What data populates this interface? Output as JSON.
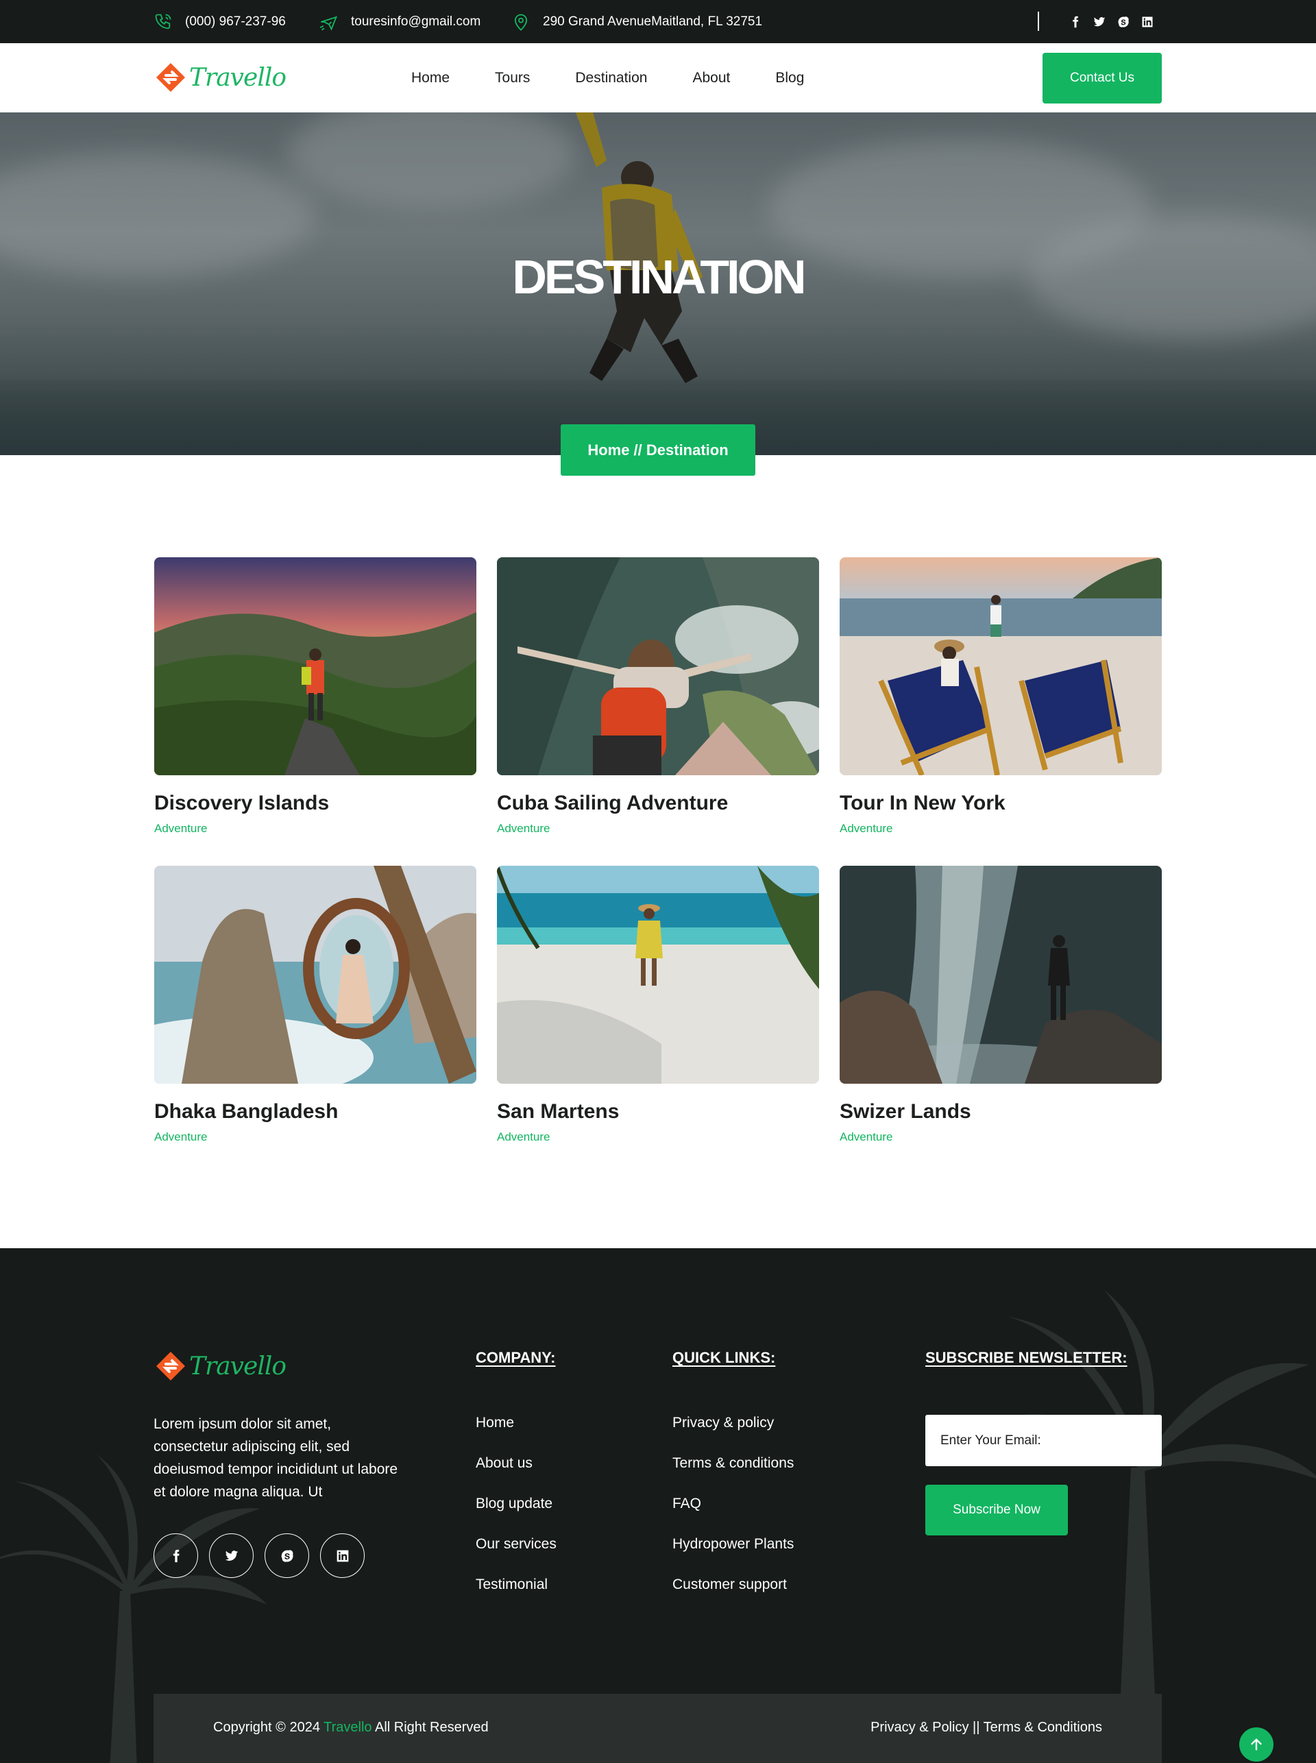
{
  "topbar": {
    "phone": "(000) 967-237-96",
    "email": "touresinfo@gmail.com",
    "address": "290 Grand AvenueMaitland, FL 32751",
    "icons": [
      "phone-icon",
      "plane-icon",
      "location-pin-icon"
    ],
    "socials": [
      "facebook-icon",
      "twitter-icon",
      "skype-icon",
      "linkedin-icon"
    ]
  },
  "brand": {
    "name": "Travello",
    "accent": "#13b561",
    "logo_mark_color": "#f25a22",
    "dark": "#171b19"
  },
  "nav": {
    "items": [
      "Home",
      "Tours",
      "Destination",
      "About",
      "Blog"
    ],
    "cta": "Contact Us"
  },
  "hero": {
    "title": "DESTINATION",
    "breadcrumb": "Home // Destination"
  },
  "destinations": [
    {
      "title": "Discovery Islands",
      "tag": "Adventure"
    },
    {
      "title": "Cuba Sailing Adventure",
      "tag": "Adventure"
    },
    {
      "title": "Tour In New York",
      "tag": "Adventure"
    },
    {
      "title": "Dhaka Bangladesh",
      "tag": "Adventure"
    },
    {
      "title": "San Martens",
      "tag": "Adventure"
    },
    {
      "title": "Swizer Lands",
      "tag": "Adventure"
    }
  ],
  "footer": {
    "about": "Lorem ipsum dolor sit amet, consectetur adipiscing elit, sed doeiusmod tempor incididunt ut labore et dolore magna aliqua. Ut",
    "company": {
      "heading": "COMPANY:",
      "links": [
        "Home",
        "About us",
        "Blog update",
        "Our services",
        "Testimonial"
      ]
    },
    "quick_links": {
      "heading": "QUICK LINKS:",
      "links": [
        "Privacy & policy",
        "Terms & conditions",
        "FAQ",
        "Hydropower Plants",
        "Customer support"
      ]
    },
    "newsletter": {
      "heading": "SUBSCRIBE NEWSLETTER:",
      "placeholder": "Enter Your Email:",
      "button": "Subscribe Now"
    },
    "copyright_prefix": "Copyright © 2024",
    "copyright_brand": "Travello",
    "copyright_suffix": "All Right Reserved",
    "bottom_links": "Privacy & Policy || Terms & Conditions"
  }
}
